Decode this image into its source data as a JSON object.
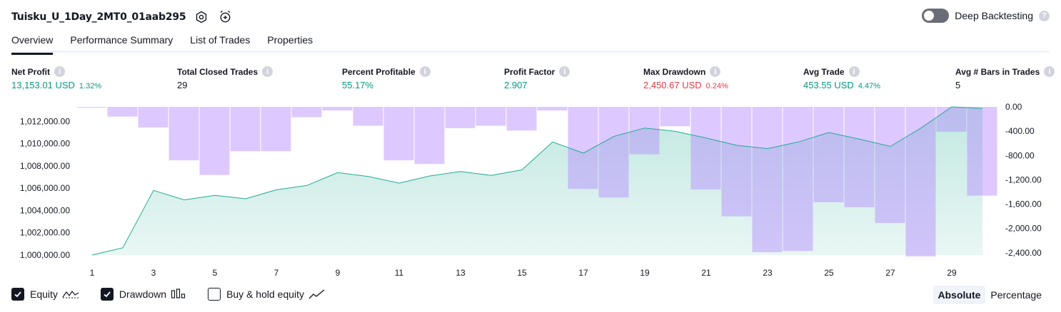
{
  "header": {
    "strategy_name": "Tuisku_U_1Day_2MT0_01aab295",
    "settings_icon": "settings-icon",
    "alert_icon": "add-alert-icon"
  },
  "deep_backtesting": {
    "label": "Deep Backtesting",
    "enabled": false,
    "help_icon": "question-icon"
  },
  "tabs": [
    {
      "label": "Overview",
      "active": true
    },
    {
      "label": "Performance Summary",
      "active": false
    },
    {
      "label": "List of Trades",
      "active": false
    },
    {
      "label": "Properties",
      "active": false
    }
  ],
  "metrics": [
    {
      "label": "Net Profit",
      "value": "13,153.01 USD",
      "pct": "1.32%",
      "tone": "green"
    },
    {
      "label": "Total Closed Trades",
      "value": "29",
      "pct": "",
      "tone": ""
    },
    {
      "label": "Percent Profitable",
      "value": "55.17%",
      "pct": "",
      "tone": "green"
    },
    {
      "label": "Profit Factor",
      "value": "2.907",
      "pct": "",
      "tone": "green"
    },
    {
      "label": "Max Drawdown",
      "value": "2,450.67 USD",
      "pct": "0.24%",
      "tone": "red"
    },
    {
      "label": "Avg Trade",
      "value": "453.55 USD",
      "pct": "4.47%",
      "tone": "green"
    },
    {
      "label": "Avg # Bars in Trades",
      "value": "5",
      "pct": "",
      "tone": ""
    }
  ],
  "chart_data": {
    "type": "line",
    "series": [
      {
        "name": "Equity",
        "type": "area",
        "axis": "left",
        "color": "#22ab94",
        "values": [
          1000000,
          1000650,
          1005800,
          1004950,
          1005350,
          1005050,
          1005850,
          1006250,
          1007400,
          1007050,
          1006450,
          1007100,
          1007500,
          1007150,
          1007650,
          1010150,
          1009150,
          1010650,
          1011400,
          1011100,
          1010500,
          1009850,
          1009550,
          1010150,
          1011000,
          1010400,
          1009750,
          1011400,
          1013300,
          1013150
        ]
      },
      {
        "name": "Drawdown",
        "type": "bar",
        "axis": "right",
        "color": "#b39ddb",
        "values": [
          -5,
          -160,
          -340,
          -880,
          -1120,
          -730,
          -730,
          -170,
          -60,
          -310,
          -880,
          -940,
          -350,
          -310,
          -390,
          -60,
          -1350,
          -1490,
          -780,
          -320,
          -1360,
          -1800,
          -2390,
          -2370,
          -1570,
          -1650,
          -1910,
          -2460,
          -410,
          -1460
        ]
      }
    ],
    "x_ticks": [
      "1",
      "3",
      "5",
      "7",
      "9",
      "11",
      "13",
      "15",
      "17",
      "19",
      "21",
      "23",
      "25",
      "27",
      "29"
    ],
    "y_left_ticks": [
      "1,000,000.00",
      "1,002,000.00",
      "1,004,000.00",
      "1,006,000.00",
      "1,008,000.00",
      "1,010,000.00",
      "1,012,000.00"
    ],
    "y_left_range": [
      1000000,
      1013300
    ],
    "y_right_ticks": [
      "0.00",
      "-400.00",
      "-800.00",
      "-1,200.00",
      "-1,600.00",
      "-2,000.00",
      "-2,400.00"
    ],
    "y_right_range": [
      -2460,
      0
    ],
    "xlabel": "",
    "ylabel": ""
  },
  "legend": [
    {
      "label": "Equity",
      "checked": true,
      "icon": "equity-line-icon"
    },
    {
      "label": "Drawdown",
      "checked": true,
      "icon": "drawdown-bars-icon"
    },
    {
      "label": "Buy & hold equity",
      "checked": false,
      "icon": "buy-hold-line-icon"
    }
  ],
  "view_mode": {
    "options": [
      "Absolute",
      "Percentage"
    ],
    "selected": "Absolute"
  }
}
